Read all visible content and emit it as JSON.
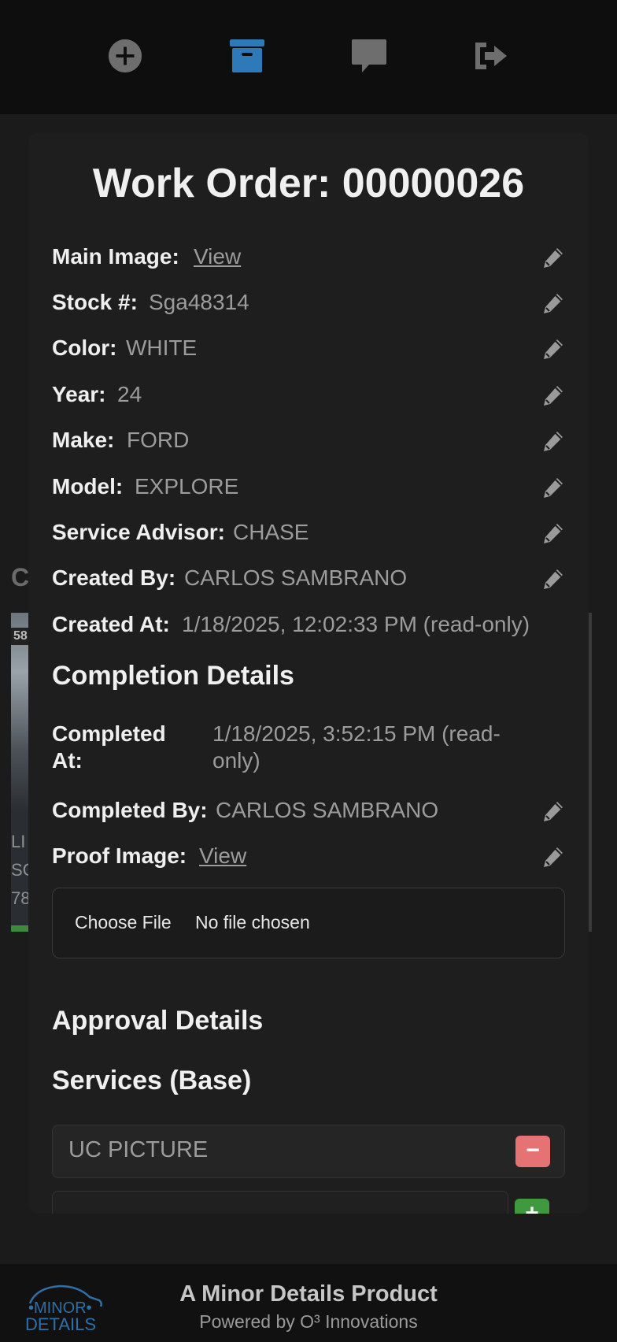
{
  "nav": {
    "items": [
      {
        "icon": "plus-circle-icon"
      },
      {
        "icon": "archive-box-icon",
        "active": true
      },
      {
        "icon": "chat-bubble-icon"
      },
      {
        "icon": "sign-out-icon"
      }
    ],
    "colors": {
      "inactive": "#6e6e6e",
      "active": "#2e7ab8"
    }
  },
  "background": {
    "heading": "C",
    "card_tag": "58",
    "card_lines": [
      "LI",
      "SC",
      "78"
    ]
  },
  "modal": {
    "title": "Work Order: 00000026",
    "fields": {
      "main_image": {
        "label": "Main Image:",
        "value": "View"
      },
      "stock": {
        "label": "Stock #:",
        "value": "Sga48314"
      },
      "color": {
        "label": "Color:",
        "value": "WHITE"
      },
      "year": {
        "label": "Year:",
        "value": "24"
      },
      "make": {
        "label": "Make:",
        "value": "FORD"
      },
      "model": {
        "label": "Model:",
        "value": "EXPLORE"
      },
      "service_advisor": {
        "label": "Service Advisor:",
        "value": "CHASE"
      },
      "created_by": {
        "label": "Created By:",
        "value": "CARLOS SAMBRANO"
      },
      "created_at": {
        "label": "Created At:",
        "value": "1/18/2025, 12:02:33 PM (read-only)"
      }
    },
    "completion": {
      "title": "Completion Details",
      "completed_at": {
        "label": "Completed At:",
        "value": "1/18/2025, 3:52:15 PM (read-only)"
      },
      "completed_by": {
        "label": "Completed By:",
        "value": "CARLOS SAMBRANO"
      },
      "proof_image": {
        "label": "Proof Image:",
        "value": "View"
      },
      "file_button": "Choose File",
      "file_status": "No file chosen"
    },
    "approval": {
      "title": "Approval Details"
    },
    "services": {
      "title": "Services (Base)",
      "items": [
        "UC PICTURE"
      ],
      "remove_label": "−",
      "add_label": "+",
      "new_value": ""
    }
  },
  "footer": {
    "logo_text_top": "MINOR",
    "logo_text_bottom": "DETAILS",
    "title": "A Minor Details Product",
    "subtitle": "Powered by O³ Innovations"
  },
  "colors": {
    "accent": "#2e7ab8",
    "remove": "#e57373",
    "add": "#3f9a3f"
  }
}
